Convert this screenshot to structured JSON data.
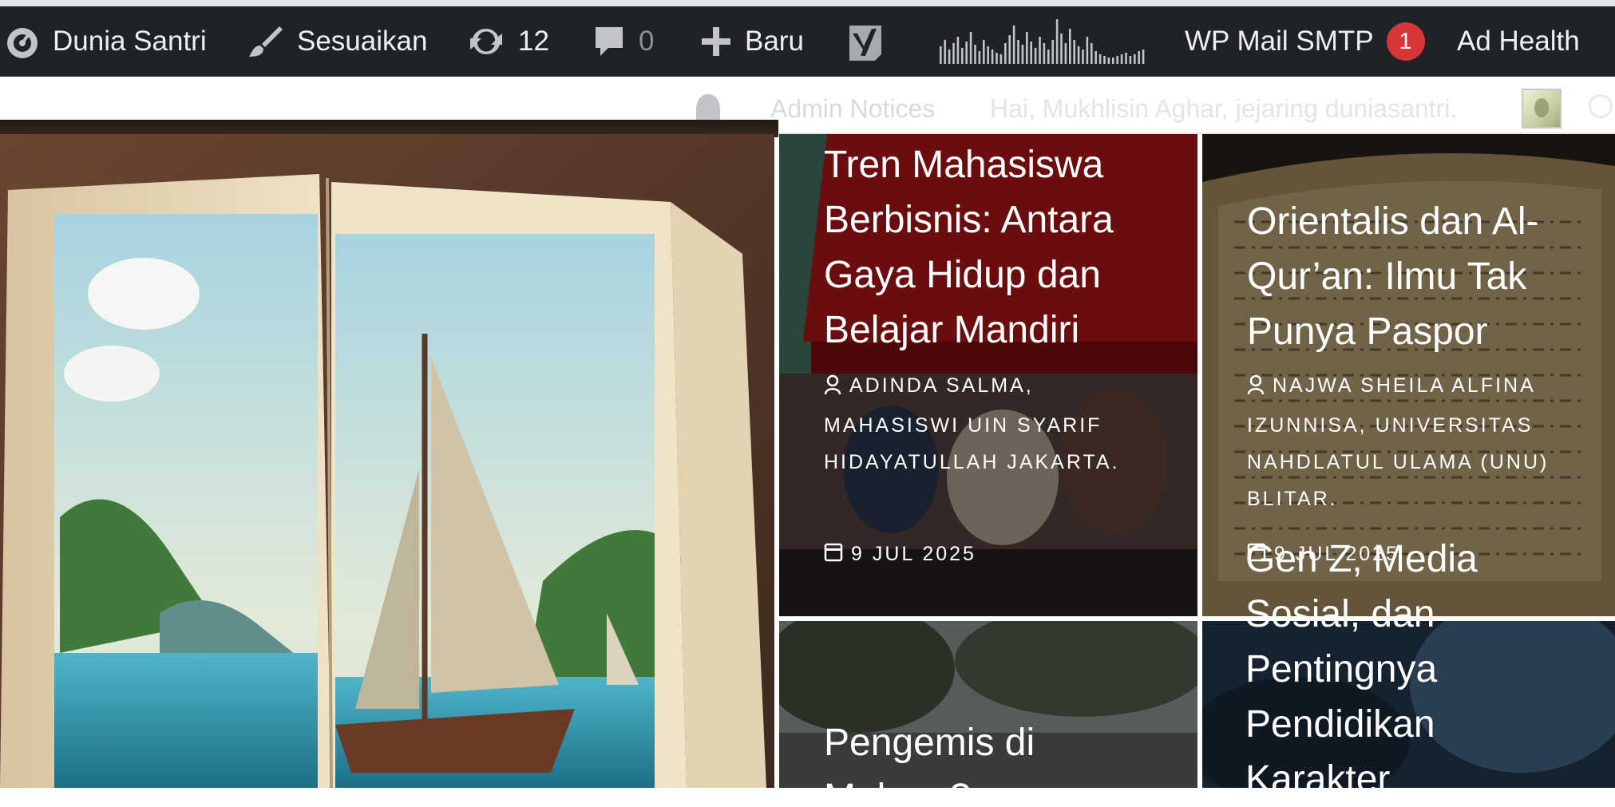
{
  "admin_bar": {
    "site_name": "Dunia Santri",
    "customize_label": "Sesuaikan",
    "updates_count": "12",
    "comments_count": "0",
    "new_label": "Baru",
    "wp_mail_smtp_label": "WP Mail SMTP",
    "wp_mail_smtp_badge": "1",
    "ad_health_label": "Ad Health"
  },
  "sub_bar": {
    "notices_label": "Admin Notices",
    "greeting": "Hai, Mukhlisin Aghar, jejaring duniasantri."
  },
  "posts": [
    {
      "title": "Tren Mahasiswa Berbisnis: Antara Gaya Hidup dan Belajar Mandiri",
      "author": "Adinda Salma, Mahasiswi UIN Syarif Hidayatullah Jakarta.",
      "date": "9 JUL 2025"
    },
    {
      "title": "Orientalis dan Al-Qur’an: Ilmu Tak Punya Paspor",
      "author": "Najwa Sheila Alfina Izunnisa, Universitas Nahdlatul Ulama (UNU) Blitar.",
      "date": "9 JUL 2025"
    },
    {
      "title": "Pengemis di Makam? ...",
      "author": "",
      "date": ""
    },
    {
      "title": "Gen Z, Media Sosial, dan Pentingnya Pendidikan Karakter",
      "author": "",
      "date": ""
    }
  ],
  "colors": {
    "admin_bar_bg": "#1d2327",
    "badge_red": "#d63638",
    "text_white": "#ffffff"
  },
  "icons": [
    "dashboard-icon",
    "brush-icon",
    "refresh-icon",
    "comment-icon",
    "plus-icon",
    "yoast-icon",
    "bell-icon",
    "user-icon",
    "calendar-icon"
  ]
}
